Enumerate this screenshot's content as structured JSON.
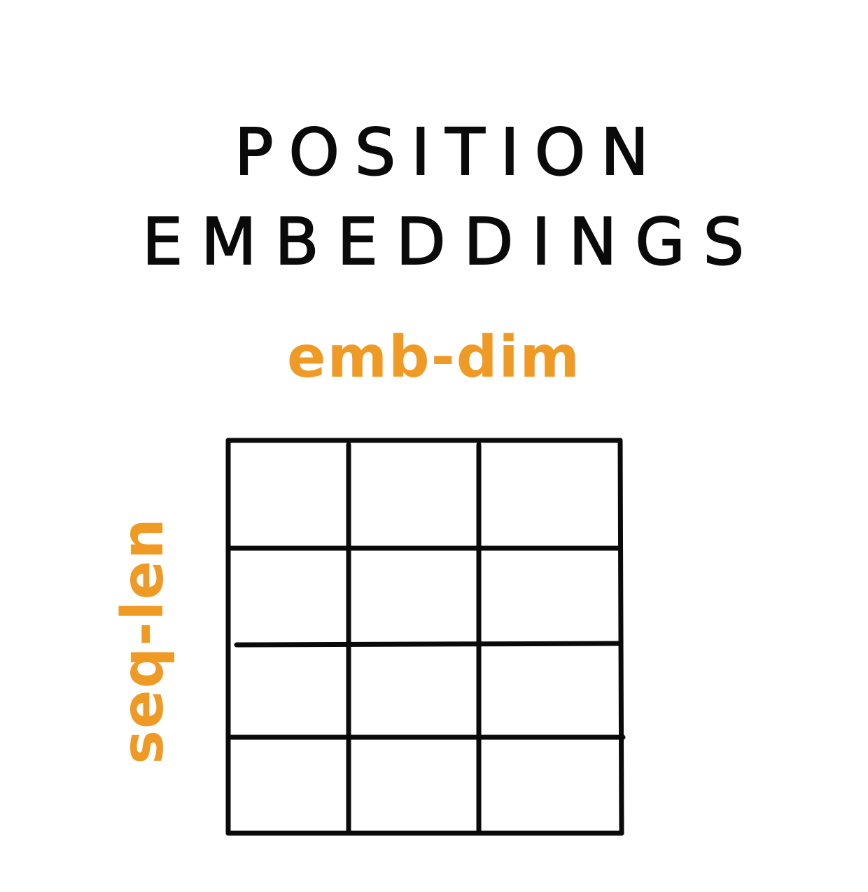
{
  "title": {
    "line1": "POSITION",
    "line2": "EMBEDDINGS"
  },
  "labels": {
    "columns": "emb-dim",
    "rows": "seq-len"
  },
  "grid": {
    "rows": 4,
    "cols": 3
  },
  "colors": {
    "ink": "#0a0a0a",
    "accent": "#f09a26"
  }
}
